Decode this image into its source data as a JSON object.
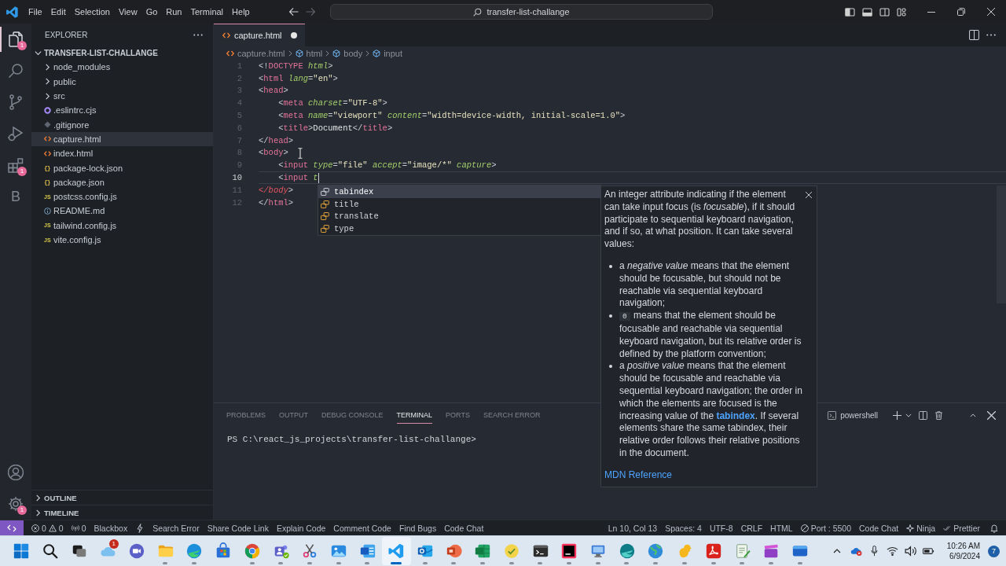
{
  "title_bar": {
    "menus": [
      "File",
      "Edit",
      "Selection",
      "View",
      "Go",
      "Run",
      "Terminal",
      "Help"
    ],
    "nav": [
      {
        "kind": "back",
        "disabled": false
      },
      {
        "kind": "forward",
        "disabled": true
      }
    ],
    "command_center": "transfer-list-challange",
    "layout_toggles": [
      {
        "kind": "primary-sidebar",
        "on": true
      },
      {
        "kind": "panel",
        "on": true
      },
      {
        "kind": "secondary-sidebar",
        "on": false
      }
    ]
  },
  "activity_bar": {
    "top": [
      {
        "kind": "explorer",
        "selected": true,
        "badge": "1"
      },
      {
        "kind": "search",
        "selected": false
      },
      {
        "kind": "source-control",
        "selected": false
      },
      {
        "kind": "run-debug",
        "selected": false
      },
      {
        "kind": "extensions",
        "selected": false,
        "badge": "1"
      },
      {
        "kind": "letter",
        "selected": false,
        "glyph": "B"
      }
    ],
    "bottom": [
      {
        "kind": "account"
      },
      {
        "kind": "manage",
        "badge": "1"
      }
    ]
  },
  "sidebar": {
    "title": "EXPLORER",
    "tree": [
      {
        "label": "TRANSFER-LIST-CHALLANGE",
        "kind": "root",
        "expanded": true,
        "selected": false,
        "children": [
          {
            "label": "node_modules",
            "kind": "folder",
            "expanded": false,
            "selected": false
          },
          {
            "label": "public",
            "kind": "folder",
            "expanded": false,
            "selected": false
          },
          {
            "label": "src",
            "kind": "folder",
            "expanded": false,
            "selected": false
          },
          {
            "label": ".eslintrc.cjs",
            "kind": "eslint",
            "selected": false
          },
          {
            "label": ".gitignore",
            "kind": "git",
            "selected": false
          },
          {
            "label": "capture.html",
            "kind": "html",
            "selected": true
          },
          {
            "label": "index.html",
            "kind": "html",
            "selected": false
          },
          {
            "label": "package-lock.json",
            "kind": "json",
            "glyph": "{}",
            "selected": false
          },
          {
            "label": "package.json",
            "kind": "json",
            "glyph": "{}",
            "selected": false
          },
          {
            "label": "postcss.config.js",
            "kind": "js",
            "glyph": "JS",
            "selected": false
          },
          {
            "label": "README.md",
            "kind": "info",
            "selected": false
          },
          {
            "label": "tailwind.config.js",
            "kind": "js",
            "glyph": "JS",
            "selected": false
          },
          {
            "label": "vite.config.js",
            "kind": "js",
            "glyph": "JS",
            "selected": false
          }
        ]
      }
    ],
    "sections": [
      {
        "label": "OUTLINE",
        "expanded": false
      },
      {
        "label": "TIMELINE",
        "expanded": false
      }
    ]
  },
  "editor": {
    "tabs": [
      {
        "label": "capture.html",
        "selected": true,
        "modified": true
      }
    ],
    "breadcrumbs": [
      {
        "label": "capture.html",
        "kind": "file"
      },
      {
        "label": "html",
        "kind": "element"
      },
      {
        "label": "body",
        "kind": "element"
      },
      {
        "label": "input",
        "kind": "element"
      }
    ],
    "lines": [
      {
        "number": "1",
        "current": false,
        "tokens": [
          {
            "kind": "punct",
            "text": "<!"
          },
          {
            "kind": "tag",
            "text": "DOCTYPE"
          },
          {
            "kind": "attr",
            "text": " html"
          },
          {
            "kind": "punct",
            "text": ">"
          }
        ]
      },
      {
        "number": "2",
        "current": false,
        "tokens": [
          {
            "kind": "punct",
            "text": "<"
          },
          {
            "kind": "tag",
            "text": "html"
          },
          {
            "kind": "attr",
            "text": " lang"
          },
          {
            "kind": "punct",
            "text": "="
          },
          {
            "kind": "string",
            "text": "\"en\""
          },
          {
            "kind": "punct",
            "text": ">"
          }
        ]
      },
      {
        "number": "3",
        "current": false,
        "tokens": [
          {
            "kind": "punct",
            "text": "<"
          },
          {
            "kind": "tag",
            "text": "head"
          },
          {
            "kind": "punct",
            "text": ">"
          }
        ]
      },
      {
        "number": "4",
        "current": false,
        "tokens": [
          {
            "kind": "punct",
            "text": "    <"
          },
          {
            "kind": "tag",
            "text": "meta"
          },
          {
            "kind": "attr",
            "text": " charset"
          },
          {
            "kind": "punct",
            "text": "="
          },
          {
            "kind": "string",
            "text": "\"UTF-8\""
          },
          {
            "kind": "punct",
            "text": ">"
          }
        ]
      },
      {
        "number": "5",
        "current": false,
        "tokens": [
          {
            "kind": "punct",
            "text": "    <"
          },
          {
            "kind": "tag",
            "text": "meta"
          },
          {
            "kind": "attr",
            "text": " name"
          },
          {
            "kind": "punct",
            "text": "="
          },
          {
            "kind": "string",
            "text": "\"viewport\""
          },
          {
            "kind": "attr",
            "text": " content"
          },
          {
            "kind": "punct",
            "text": "="
          },
          {
            "kind": "string",
            "text": "\"width=device-width, initial-scale=1.0\""
          },
          {
            "kind": "punct",
            "text": ">"
          }
        ]
      },
      {
        "number": "6",
        "current": false,
        "tokens": [
          {
            "kind": "punct",
            "text": "    <"
          },
          {
            "kind": "tag",
            "text": "title"
          },
          {
            "kind": "punct",
            "text": ">"
          },
          {
            "kind": "text",
            "text": "Document"
          },
          {
            "kind": "punct",
            "text": "</"
          },
          {
            "kind": "tag",
            "text": "title"
          },
          {
            "kind": "punct",
            "text": ">"
          }
        ]
      },
      {
        "number": "7",
        "current": false,
        "tokens": [
          {
            "kind": "punct",
            "text": "</"
          },
          {
            "kind": "tag",
            "text": "head"
          },
          {
            "kind": "punct",
            "text": ">"
          }
        ]
      },
      {
        "number": "8",
        "current": false,
        "tokens": [
          {
            "kind": "punct",
            "text": "<"
          },
          {
            "kind": "tag",
            "text": "body"
          },
          {
            "kind": "punct",
            "text": ">"
          }
        ]
      },
      {
        "number": "9",
        "current": false,
        "tokens": [
          {
            "kind": "punct",
            "text": "    <"
          },
          {
            "kind": "tag",
            "text": "input"
          },
          {
            "kind": "attr",
            "text": " type"
          },
          {
            "kind": "punct",
            "text": "="
          },
          {
            "kind": "string",
            "text": "\"file\""
          },
          {
            "kind": "attr",
            "text": " accept"
          },
          {
            "kind": "punct",
            "text": "="
          },
          {
            "kind": "string",
            "text": "\"image/*\""
          },
          {
            "kind": "attr",
            "text": " capture"
          },
          {
            "kind": "punct",
            "text": ">"
          }
        ]
      },
      {
        "number": "10",
        "current": true,
        "tokens": [
          {
            "kind": "punct",
            "text": "    <"
          },
          {
            "kind": "tag",
            "text": "input"
          },
          {
            "kind": "attr",
            "text": " t"
          }
        ]
      },
      {
        "number": "11",
        "current": false,
        "tokens": [
          {
            "kind": "error",
            "text": "</body"
          },
          {
            "kind": "punct",
            "text": ">"
          }
        ]
      },
      {
        "number": "12",
        "current": false,
        "tokens": [
          {
            "kind": "punct",
            "text": "</"
          },
          {
            "kind": "tag",
            "text": "html"
          },
          {
            "kind": "punct",
            "text": ">"
          }
        ]
      }
    ],
    "suggest": {
      "items": [
        {
          "label": "tabindex",
          "selected": true
        },
        {
          "label": "title",
          "selected": false
        },
        {
          "label": "translate",
          "selected": false
        },
        {
          "label": "type",
          "selected": false
        }
      ],
      "details": {
        "intro": "An integer attribute indicating if the element can take input focus (is *focusable*), if it should participate to sequential keyboard navigation, and if so, at what position. It can take several values:",
        "bullets": [
          {
            "parts": [
              {
                "kind": "text",
                "text": "a *negative value* means that the element should be focusable, but should not be reachable via sequential keyboard navigation;"
              }
            ]
          },
          {
            "parts": [
              {
                "kind": "code",
                "text": "0"
              },
              {
                "kind": "text",
                "text": " means that the element should be focusable and reachable via sequential keyboard navigation, but its relative order is defined by the platform convention;"
              }
            ]
          },
          {
            "parts": [
              {
                "kind": "text",
                "text": "a *positive value* means that the element should be focusable and reachable via sequential keyboard navigation; the order in which the elements are focused is the increasing value of the "
              },
              {
                "kind": "link",
                "text": "tabindex"
              },
              {
                "kind": "text",
                "text": ". If several elements share the same tabindex, their relative order follows their relative positions in the document."
              }
            ]
          }
        ],
        "link": "MDN Reference"
      }
    }
  },
  "panel": {
    "tabs": [
      {
        "label": "PROBLEMS",
        "selected": false
      },
      {
        "label": "OUTPUT",
        "selected": false
      },
      {
        "label": "DEBUG CONSOLE",
        "selected": false
      },
      {
        "label": "TERMINAL",
        "selected": true
      },
      {
        "label": "PORTS",
        "selected": false
      },
      {
        "label": "SEARCH ERROR",
        "selected": false
      }
    ],
    "terminal_name": "powershell",
    "terminal_lines": [
      "PS C:\\react_js_projects\\transfer-list-challange>"
    ]
  },
  "status_bar": {
    "left": [
      {
        "kind": "problems",
        "errors": "0",
        "warnings": "0"
      },
      {
        "kind": "broadcast",
        "text": "0"
      },
      {
        "kind": "plain",
        "text": "Blackbox"
      },
      {
        "kind": "bolt"
      },
      {
        "kind": "plain",
        "text": "Search Error"
      },
      {
        "kind": "plain",
        "text": "Share Code Link"
      },
      {
        "kind": "plain",
        "text": "Explain Code"
      },
      {
        "kind": "plain",
        "text": "Comment Code"
      },
      {
        "kind": "plain",
        "text": "Find Bugs"
      },
      {
        "kind": "plain",
        "text": "Code Chat"
      }
    ],
    "right": [
      {
        "kind": "plain",
        "text": "Ln 10, Col 13"
      },
      {
        "kind": "plain",
        "text": "Spaces: 4"
      },
      {
        "kind": "plain",
        "text": "UTF-8"
      },
      {
        "kind": "plain",
        "text": "CRLF"
      },
      {
        "kind": "plain",
        "text": "HTML"
      },
      {
        "kind": "port",
        "text": "Port : 5500"
      },
      {
        "kind": "plain",
        "text": "Code Chat"
      },
      {
        "kind": "ninja",
        "text": "Ninja"
      },
      {
        "kind": "prettier",
        "text": "Prettier"
      },
      {
        "kind": "bell"
      }
    ]
  },
  "taskbar": {
    "apps": [
      {
        "kind": "start",
        "running": false,
        "selected": false
      },
      {
        "kind": "search",
        "running": false,
        "selected": false
      },
      {
        "kind": "task-view",
        "running": false,
        "selected": false
      },
      {
        "kind": "cloud",
        "running": false,
        "selected": false,
        "badge": "1"
      },
      {
        "kind": "video-call",
        "running": false,
        "selected": false
      },
      {
        "kind": "folder",
        "running": true,
        "selected": false
      },
      {
        "kind": "browser-swirl",
        "running": true,
        "selected": false
      },
      {
        "kind": "bag",
        "running": false,
        "selected": false
      },
      {
        "kind": "browser-round",
        "running": true,
        "selected": false
      },
      {
        "kind": "team",
        "running": true,
        "selected": false
      },
      {
        "kind": "scissors",
        "running": true,
        "selected": false
      },
      {
        "kind": "image",
        "running": true,
        "selected": false
      },
      {
        "kind": "document",
        "running": true,
        "selected": false
      },
      {
        "kind": "code-editor",
        "running": true,
        "selected": true
      },
      {
        "kind": "mail",
        "running": true,
        "selected": false
      },
      {
        "kind": "presentation",
        "running": true,
        "selected": false
      },
      {
        "kind": "spreadsheet",
        "running": true,
        "selected": false
      },
      {
        "kind": "check-circle",
        "running": true,
        "selected": false
      },
      {
        "kind": "terminal",
        "running": true,
        "selected": false
      },
      {
        "kind": "ide",
        "running": true,
        "selected": false
      },
      {
        "kind": "monitor",
        "running": true,
        "selected": false
      },
      {
        "kind": "browser-dark",
        "running": true,
        "selected": false
      },
      {
        "kind": "globe",
        "running": true,
        "selected": false
      },
      {
        "kind": "duck",
        "running": true,
        "selected": false
      },
      {
        "kind": "pdf",
        "running": true,
        "selected": false
      },
      {
        "kind": "notepad",
        "running": true,
        "selected": false
      },
      {
        "kind": "clapperboard",
        "running": true,
        "selected": false
      },
      {
        "kind": "window",
        "running": true,
        "selected": false
      }
    ],
    "tray": {
      "time": "10:26 AM",
      "date": "6/9/2024",
      "notifications": "7"
    }
  }
}
